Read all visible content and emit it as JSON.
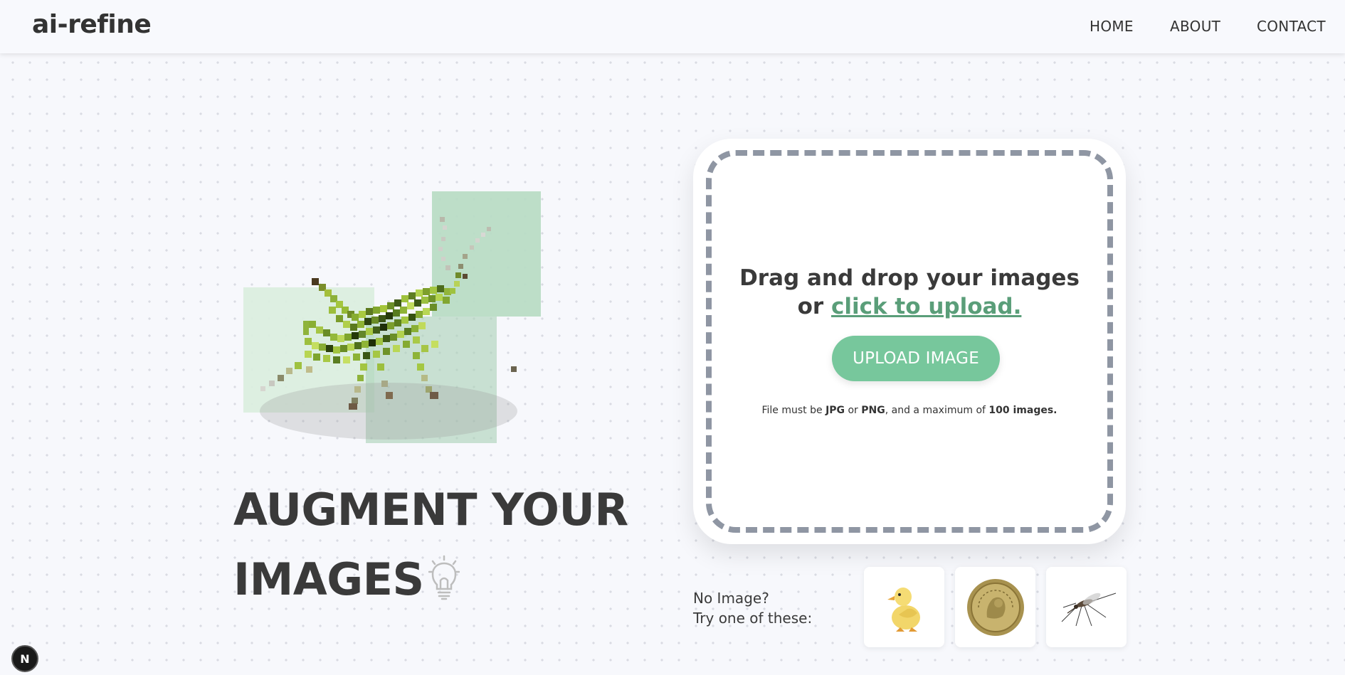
{
  "brand": {
    "name": "ai-refine"
  },
  "nav": {
    "items": [
      {
        "label": "HOME"
      },
      {
        "label": "ABOUT"
      },
      {
        "label": "CONTACT"
      }
    ]
  },
  "hero": {
    "title_line1": "AUGMENT YOUR",
    "title_line2": "IMAGES",
    "illustration_icon": "grasshopper-pixelated",
    "title_icon": "lightbulb-icon"
  },
  "upload": {
    "prompt_prefix": "Drag and drop your images",
    "prompt_or": "or ",
    "prompt_link": "click to upload.",
    "button_label": "UPLOAD IMAGE",
    "note": {
      "part1": "File must be ",
      "format1": "JPG",
      "part2": " or ",
      "format2": "PNG",
      "part3": ", and a maximum of ",
      "limit": "100 images."
    }
  },
  "samples": {
    "label_line1": "No Image?",
    "label_line2": "Try one of these:",
    "items": [
      {
        "icon": "duckling-icon"
      },
      {
        "icon": "coin-icon"
      },
      {
        "icon": "mosquito-icon"
      }
    ]
  },
  "dev_badge": {
    "label": "N"
  },
  "colors": {
    "accent": "#77c79c",
    "link": "#5a9e79",
    "text": "#3a3a3a",
    "background": "#f7f8fc",
    "dashed_border": "#8f96a3"
  }
}
